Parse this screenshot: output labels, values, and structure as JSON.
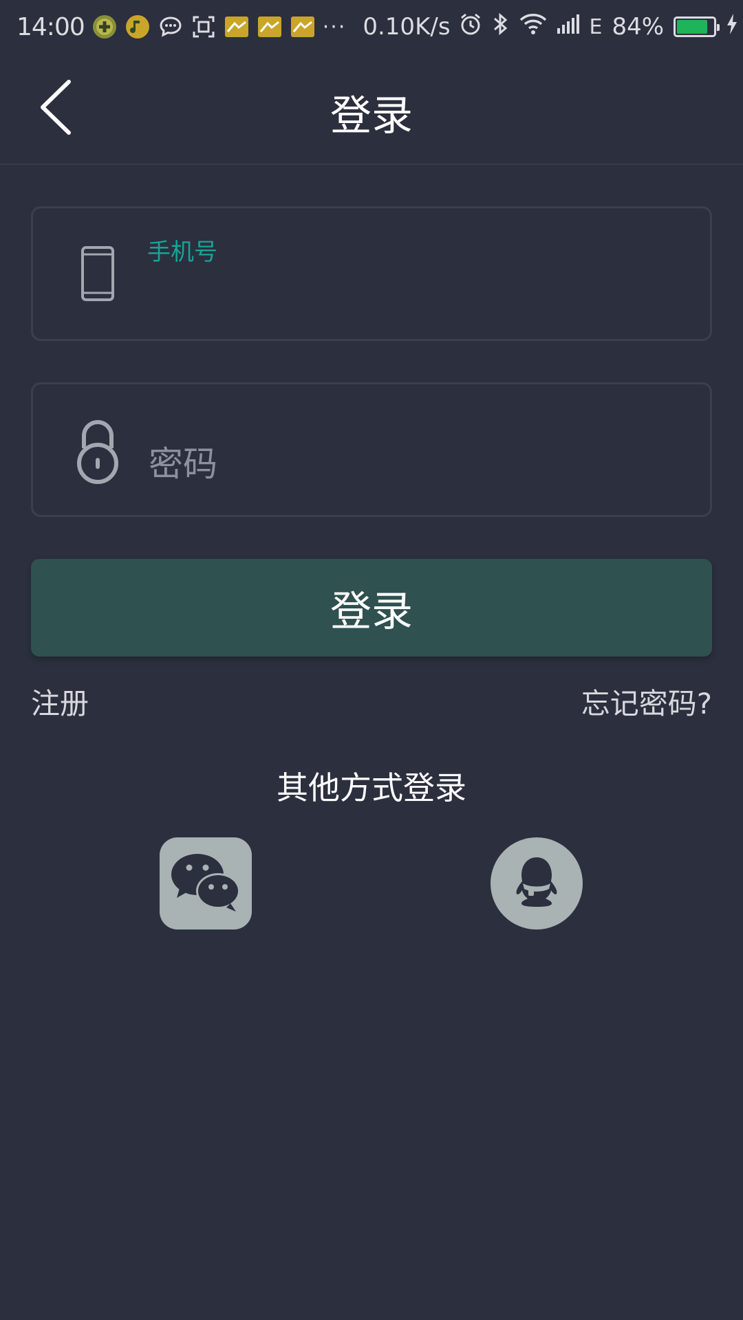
{
  "status_bar": {
    "time": "14:00",
    "dots": "···",
    "net_speed": "0.10K/s",
    "network_type": "E",
    "battery_percent": "84%",
    "battery_level": 0.84,
    "battery_color": "#1fb35a"
  },
  "header": {
    "title": "登录"
  },
  "phone_field": {
    "label": "手机号",
    "value": "",
    "icon": "phone-icon"
  },
  "password_field": {
    "placeholder": "密码",
    "value": "",
    "icon": "lock-icon"
  },
  "login_button": {
    "label": "登录",
    "color": "#2f5150"
  },
  "links": {
    "register": "注册",
    "forgot_password": "忘记密码?"
  },
  "other_login": {
    "title": "其他方式登录",
    "options": [
      "wechat-icon",
      "qq-icon"
    ]
  },
  "colors": {
    "background": "#2c2f3e",
    "accent": "#16a596",
    "social_bg": "#a9b3b4"
  }
}
